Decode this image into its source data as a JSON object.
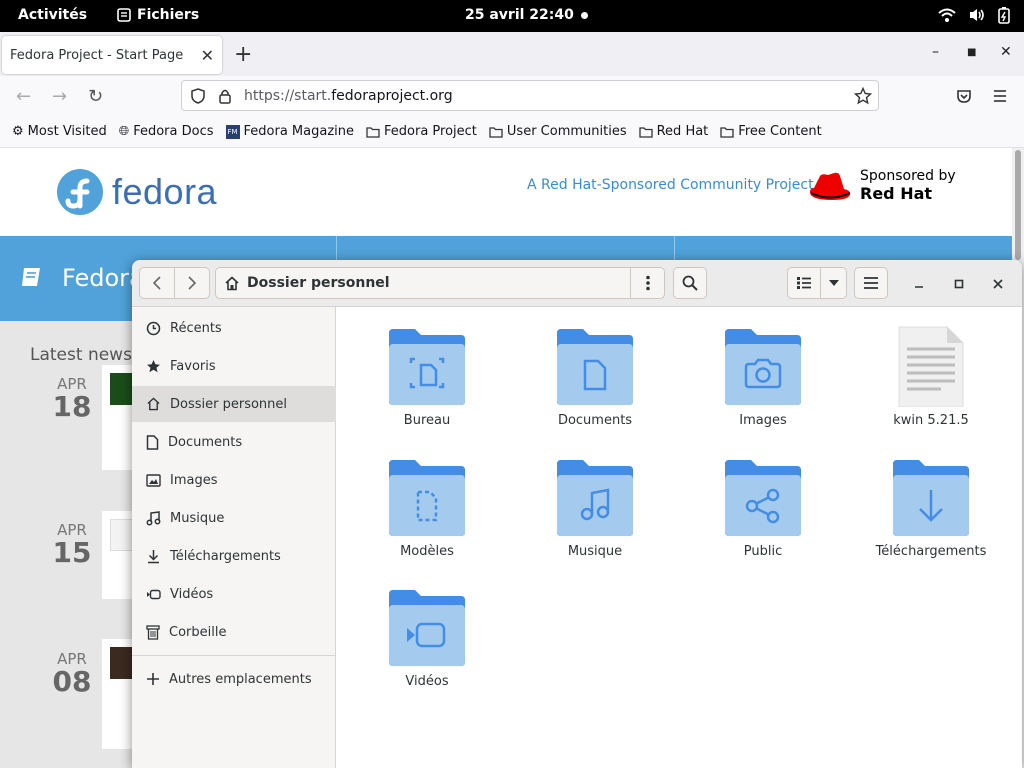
{
  "topbar": {
    "activities": "Activités",
    "app_name": "Fichiers",
    "clock": "25 avril  22:40"
  },
  "browser": {
    "tab_title": "Fedora Project - Start Page",
    "url_prefix": "https://start.",
    "url_host": "fedoraproject.org",
    "bookmarks": [
      "Most Visited",
      "Fedora Docs",
      "Fedora Magazine",
      "Fedora Project",
      "User Communities",
      "Red Hat",
      "Free Content"
    ]
  },
  "webpage": {
    "logo_text": "fedora",
    "tagline": "A Red Hat-Sponsored Community Project",
    "sponsor_line1": "Sponsored by",
    "sponsor_line2": "Red Hat",
    "section_title": "Fedora",
    "latest_news": "Latest news",
    "news": [
      {
        "month": "APR",
        "day": "18"
      },
      {
        "month": "APR",
        "day": "15"
      },
      {
        "month": "APR",
        "day": "08"
      }
    ]
  },
  "files": {
    "location": "Dossier personnel",
    "sidebar": [
      "Récents",
      "Favoris",
      "Dossier personnel",
      "Documents",
      "Images",
      "Musique",
      "Téléchargements",
      "Vidéos",
      "Corbeille"
    ],
    "other_locations": "Autres emplacements",
    "items": [
      "Bureau",
      "Documents",
      "Images",
      "kwin 5.21.5",
      "Modèles",
      "Musique",
      "Public",
      "Téléchargements",
      "Vidéos"
    ]
  },
  "colors": {
    "folder_top": "#438de6",
    "folder_body": "#a4caee",
    "fedora_blue": "#51a2da"
  }
}
